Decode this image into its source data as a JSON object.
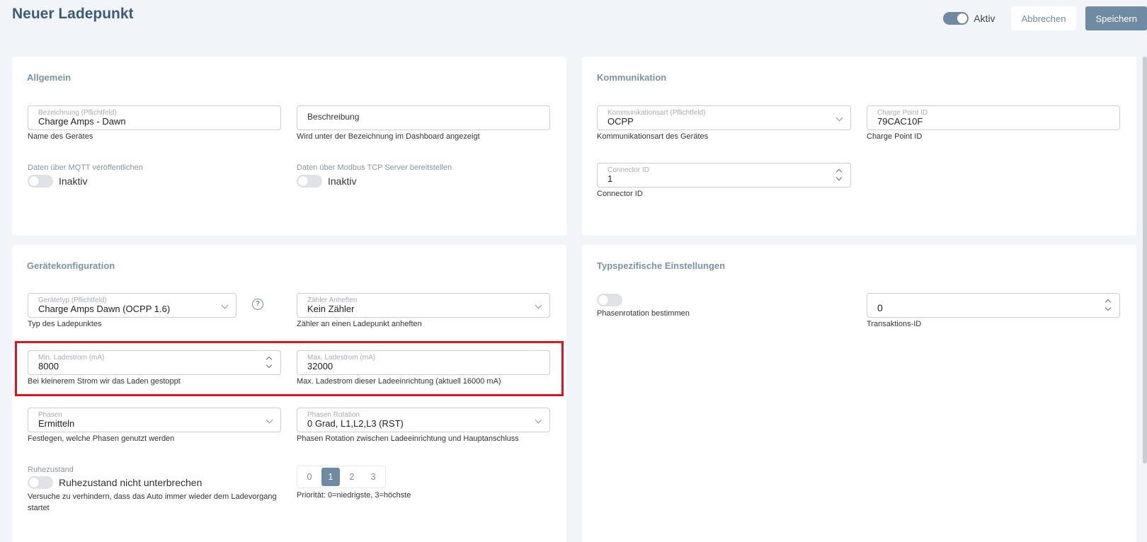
{
  "header": {
    "title": "Neuer Ladepunkt",
    "aktiv_label": "Aktiv",
    "cancel_label": "Abbrechen",
    "save_label": "Speichern"
  },
  "allgemein": {
    "title": "Allgemein",
    "bezeichnung": {
      "label": "Bezeichnung (Pflichtfeld)",
      "value": "Charge Amps - Dawn",
      "hint": "Name des Gerätes"
    },
    "beschreibung": {
      "placeholder": "Beschreibung",
      "hint": "Wird unter der Bezeichnung im Dashboard angezeigt"
    },
    "mqtt": {
      "label": "Daten über MQTT veröffentlichen",
      "state": "Inaktiv"
    },
    "modbus": {
      "label": "Daten über Modbus TCP Server bereitstellen",
      "state": "Inaktiv"
    }
  },
  "kommunikation": {
    "title": "Kommunikation",
    "art": {
      "label": "Kommunikationsart (Pflichtfeld)",
      "value": "OCPP",
      "hint": "Kommunikationsart des Gerätes"
    },
    "charge_point_id": {
      "label": "Charge Point ID",
      "value": "79CAC10F",
      "hint": "Charge Point ID"
    },
    "connector_id": {
      "label": "Connector ID",
      "value": "1",
      "hint": "Connector ID"
    }
  },
  "geraetekonfiguration": {
    "title": "Gerätekonfiguration",
    "geraetetyp": {
      "label": "Gerätetyp (Pflichtfeld)",
      "value": "Charge Amps Dawn (OCPP 1.6)",
      "hint": "Typ des Ladepunktes"
    },
    "zaehler": {
      "label": "Zähler Anheften",
      "value": "Kein Zähler",
      "hint": "Zähler an einen Ladepunkt anheften"
    },
    "min_ladestrom": {
      "label": "Min. Ladestrom (mA)",
      "value": "8000",
      "hint": "Bei kleinerem Strom wir das Laden gestoppt"
    },
    "max_ladestrom": {
      "label": "Max. Ladestrom (mA)",
      "value": "32000",
      "hint": "Max. Ladestrom dieser Ladeeinrichtung (aktuell 16000 mA)"
    },
    "phasen": {
      "label": "Phasen",
      "value": "Ermitteln",
      "hint": "Festlegen, welche Phasen genutzt werden"
    },
    "phasen_rotation": {
      "label": "Phasen Rotation",
      "value": "0 Grad, L1,L2,L3 (RST)",
      "hint": "Phasen Rotation zwischen Ladeeinrichtung und Hauptanschluss"
    },
    "ruhezustand": {
      "label": "Ruhezustand",
      "state": "Ruhezustand nicht unterbrechen",
      "hint_line1": "Versuche zu verhindern, dass das Auto immer wieder dem Ladevorgang",
      "hint_line2": "startet"
    },
    "prioritaet": {
      "options": [
        "0",
        "1",
        "2",
        "3"
      ],
      "selected": "1",
      "hint": "Priorität: 0=niedrigste, 3=höchste"
    },
    "help_glyph": "?"
  },
  "typspezifisch": {
    "title": "Typspezifische Einstellungen",
    "phasenrotation": {
      "label": "Phasenrotation bestimmen"
    },
    "transaktions_id": {
      "value": "0",
      "hint": "Transaktions-ID"
    }
  },
  "icons": [
    "chevron-down-icon",
    "spinner-arrows-icon",
    "help-icon",
    "toggle-switch"
  ],
  "colors": {
    "accent": "#6f8ba3",
    "title": "#3b5b7a",
    "highlight": "#e0141e",
    "background": "#f1f4f8"
  }
}
